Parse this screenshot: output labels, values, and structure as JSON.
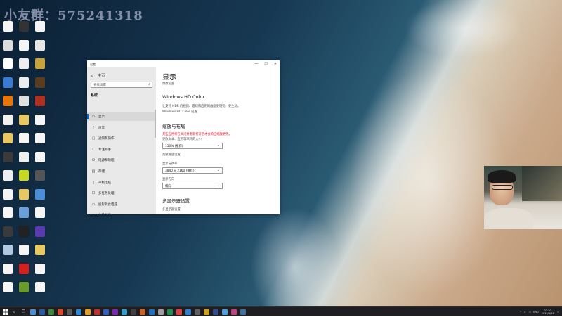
{
  "watermark": "小友群：575241318",
  "desktop_icons": [
    {
      "id": "r1c1",
      "color": "#f5f5f5",
      "label": ""
    },
    {
      "id": "r1c2",
      "color": "#333333",
      "label": ""
    },
    {
      "id": "r1c3",
      "color": "#f5f5f5",
      "label": ""
    },
    {
      "id": "r2c1",
      "color": "#dddddd",
      "label": ""
    },
    {
      "id": "r2c2",
      "color": "#f5f5f5",
      "label": ""
    },
    {
      "id": "r2c3",
      "color": "#e8e8e8",
      "label": ""
    },
    {
      "id": "r3c1",
      "color": "#ffffff",
      "label": ""
    },
    {
      "id": "r3c2",
      "color": "#eeeeee",
      "label": ""
    },
    {
      "id": "r3c3",
      "color": "#c8a23a",
      "label": ""
    },
    {
      "id": "r4c1",
      "color": "#3a7bd5",
      "label": ""
    },
    {
      "id": "r4c2",
      "color": "#eeeeee",
      "label": ""
    },
    {
      "id": "r4c3",
      "color": "#5a3d1e",
      "label": ""
    },
    {
      "id": "r5c1",
      "color": "#e8750a",
      "label": ""
    },
    {
      "id": "r5c2",
      "color": "#e0e0e0",
      "label": ""
    },
    {
      "id": "r5c3",
      "color": "#b03020",
      "label": ""
    },
    {
      "id": "r6c1",
      "color": "#f0f0f0",
      "label": ""
    },
    {
      "id": "r6c2",
      "color": "#e8c860",
      "label": ""
    },
    {
      "id": "r6c3",
      "color": "#f5f5f5",
      "label": ""
    },
    {
      "id": "r7c1",
      "color": "#e8c860",
      "label": ""
    },
    {
      "id": "r7c2",
      "color": "#f5f5f5",
      "label": ""
    },
    {
      "id": "r7c3",
      "color": "#f5f5f5",
      "label": ""
    },
    {
      "id": "r8c1",
      "color": "#3a3a3a",
      "label": ""
    },
    {
      "id": "r8c2",
      "color": "#f0f0f0",
      "label": ""
    },
    {
      "id": "r8c3",
      "color": "#f5f5f5",
      "label": ""
    },
    {
      "id": "r9c1",
      "color": "#eeeeee",
      "label": ""
    },
    {
      "id": "r9c2",
      "color": "#c8d820",
      "label": ""
    },
    {
      "id": "r9c3",
      "color": "#555555",
      "label": ""
    },
    {
      "id": "r10c1",
      "color": "#f5f5f5",
      "label": ""
    },
    {
      "id": "r10c2",
      "color": "#e8c860",
      "label": ""
    },
    {
      "id": "r10c3",
      "color": "#4a90d9",
      "label": ""
    },
    {
      "id": "r11c1",
      "color": "#f5f5f5",
      "label": ""
    },
    {
      "id": "r11c2",
      "color": "#6aa0d8",
      "label": ""
    },
    {
      "id": "r11c3",
      "color": "#f5f5f5",
      "label": ""
    },
    {
      "id": "r12c1",
      "color": "#3a3a3a",
      "label": ""
    },
    {
      "id": "r12c2",
      "color": "#222222",
      "label": ""
    },
    {
      "id": "r12c3",
      "color": "#5a3ab0",
      "label": ""
    },
    {
      "id": "r13c1",
      "color": "#b0c8e0",
      "label": ""
    },
    {
      "id": "r13c2",
      "color": "#f5f5f5",
      "label": ""
    },
    {
      "id": "r13c3",
      "color": "#e8c860",
      "label": ""
    },
    {
      "id": "r14c1",
      "color": "#f5f5f5",
      "label": ""
    },
    {
      "id": "r14c2",
      "color": "#d42020",
      "label": ""
    },
    {
      "id": "r14c3",
      "color": "#f5f5f5",
      "label": ""
    },
    {
      "id": "r15c1",
      "color": "#f5f5f5",
      "label": ""
    },
    {
      "id": "r15c2",
      "color": "#6a9a2a",
      "label": ""
    },
    {
      "id": "r15c3",
      "color": "#f5f5f5",
      "label": ""
    }
  ],
  "settings": {
    "window_title": "设置",
    "nav": {
      "home": "主页",
      "search_placeholder": "查找设置",
      "section": "系统",
      "items": [
        {
          "icon": "▭",
          "label": "显示"
        },
        {
          "icon": "♪",
          "label": "声音"
        },
        {
          "icon": "▢",
          "label": "通知和操作"
        },
        {
          "icon": "☾",
          "label": "专注助手"
        },
        {
          "icon": "⏻",
          "label": "电源和睡眠"
        },
        {
          "icon": "▤",
          "label": "存储"
        },
        {
          "icon": "▯",
          "label": "平板电脑"
        },
        {
          "icon": "☐",
          "label": "多任务处理"
        },
        {
          "icon": "▭",
          "label": "投影到此电脑"
        },
        {
          "icon": "✕",
          "label": "体验共享"
        }
      ]
    },
    "content": {
      "title": "显示",
      "title_link": "更改设置",
      "hdr_heading": "Windows HD Color",
      "hdr_text": "让支持 HDR 的视频、游戏和应用的画面更明亮、更生动。",
      "hdr_link": "Windows HD Color 设置",
      "scale_heading": "缩放与布局",
      "warning": "某些应用将在关闭并重新打开后才会响应缩放更改。",
      "scale_label": "更改文本、应用等项目的大小",
      "scale_value": "150% (推荐)",
      "advanced_link": "高级缩放设置",
      "resolution_label": "显示分辨率",
      "resolution_value": "3840 × 2160 (推荐)",
      "orientation_label": "显示方向",
      "orientation_value": "横向",
      "multi_heading": "多显示器设置",
      "multi_link": "多显示器设置"
    }
  },
  "taskbar": {
    "apps": [
      "#4a90d9",
      "#2a5aa0",
      "#3a8a3a",
      "#d94a2a",
      "#5a5a5a",
      "#2a8ad9",
      "#e8a020",
      "#c03030",
      "#3060c0",
      "#7a2ab0",
      "#30a0d0",
      "#404040",
      "#d06020",
      "#2070c0",
      "#a0a0a0",
      "#209050",
      "#e04040",
      "#3080d0",
      "#606060",
      "#d0a020",
      "#305090",
      "#50a0e0",
      "#c04080",
      "#4070a0"
    ],
    "tray_lang": "ENG",
    "time": "22:30",
    "date": "2019/8/22"
  },
  "colors": {
    "accent": "#0067c0",
    "warning": "#e81123",
    "taskbar": "#1f1f23"
  }
}
